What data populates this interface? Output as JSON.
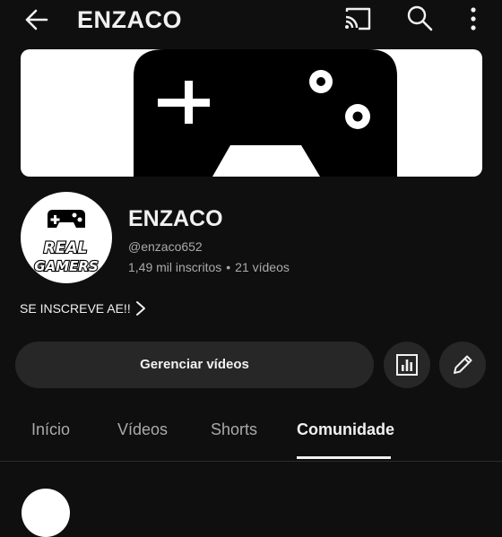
{
  "header": {
    "title": "ENZACO",
    "icons": {
      "back": "arrow-left-icon",
      "cast": "cast-icon",
      "search": "search-icon",
      "more": "more-vertical-icon"
    }
  },
  "banner": {
    "description": "game controller artwork"
  },
  "channel": {
    "name": "ENZACO",
    "handle": "@enzaco652",
    "subscribers": "1,49 mil inscritos",
    "separator": "•",
    "videos": "21 vídeos",
    "avatar_text_line1": "REAL",
    "avatar_text_line2": "GAMERS"
  },
  "description": {
    "text": "SE INSCREVE AE!!"
  },
  "actions": {
    "manage_label": "Gerenciar vídeos",
    "analytics_icon": "analytics-icon",
    "edit_icon": "pencil-icon"
  },
  "tabs": [
    {
      "label": "Início",
      "active": false
    },
    {
      "label": "Vídeos",
      "active": false
    },
    {
      "label": "Shorts",
      "active": false
    },
    {
      "label": "Comunidade",
      "active": true
    }
  ],
  "colors": {
    "background": "#0f0f0f",
    "text_primary": "#f1f1f1",
    "text_secondary": "#aaaaaa",
    "button_bg": "#272727"
  }
}
